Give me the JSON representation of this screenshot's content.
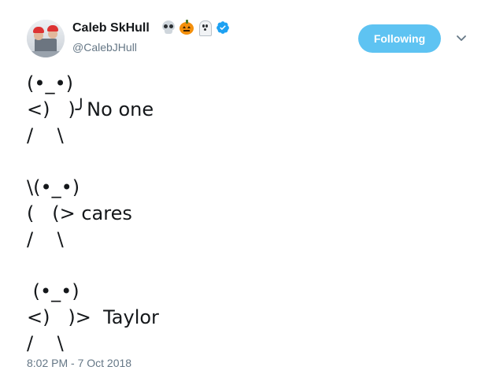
{
  "author": {
    "name": "Caleb SkHull",
    "handle": "@CalebJHull",
    "name_emojis": [
      "skull-icon",
      "jack-o-lantern-icon",
      "ghost-icon"
    ],
    "verified": true
  },
  "follow_button": {
    "label": "Following",
    "color": "#5ec3f2"
  },
  "menu": {
    "icon": "chevron-down-icon"
  },
  "tweet": {
    "text": "(•_•)\n<)   )╯No one\n/    \\\n\n\\(•_•)\n(   (> cares\n/    \\\n\n (•_•)\n<)   )>  Taylor\n/    \\",
    "timestamp": "8:02 PM - 7 Oct 2018"
  },
  "colors": {
    "text_primary": "#14171a",
    "text_secondary": "#657786",
    "verified_blue": "#1da1f2"
  }
}
